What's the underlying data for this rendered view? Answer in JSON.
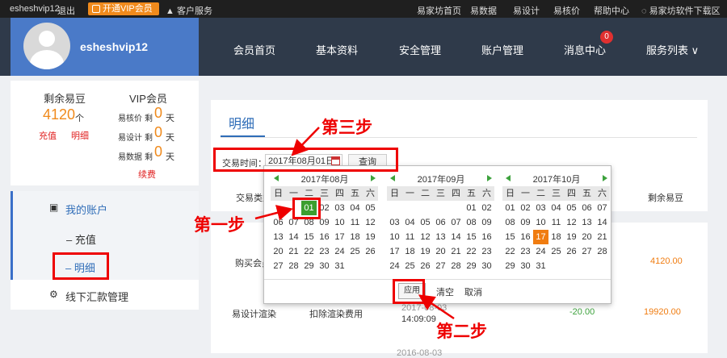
{
  "topbar": {
    "username": "esheshvip12",
    "logout": "退出",
    "vip_button": "开通VIP会员",
    "customer_service": "客户服务",
    "links": [
      "易家坊首页",
      "易数据",
      "易设计",
      "易核价",
      "帮助中心"
    ],
    "download": "易家坊软件下载区"
  },
  "header": {
    "username": "esheshvip12",
    "nav": [
      "会员首页",
      "基本资料",
      "安全管理",
      "账户管理",
      "消息中心",
      "服务列表 ∨"
    ],
    "message_count": "0"
  },
  "balance": {
    "title": "剩余易豆",
    "amount": "4120",
    "unit": "个",
    "recharge": "充值",
    "detail": "明细"
  },
  "vip": {
    "title": "VIP会员",
    "rows": [
      {
        "label": "易核价",
        "mid": "剩",
        "value": "0",
        "unit": "天"
      },
      {
        "label": "易设计",
        "mid": "剩",
        "value": "0",
        "unit": "天"
      },
      {
        "label": "易数据",
        "mid": "剩",
        "value": "0",
        "unit": "天"
      }
    ],
    "renew": "续费"
  },
  "menu": {
    "my_account": "我的账户",
    "recharge": "– 充值",
    "detail": "– 明细",
    "offline": "线下汇款管理"
  },
  "main": {
    "tab": "明细",
    "time_label": "交易时间：",
    "date_value": "2017年08月01日",
    "query_button": "查询",
    "col_type": "交易类型",
    "col_balance": "剩余易豆",
    "row1_type": "购买会员",
    "row1_balance": "4120.00",
    "row2_type": "易设计渲染",
    "row2_desc": "扣除渲染费用",
    "row2_time": "14:09:09",
    "row2_time_top": "2017-08-03",
    "row2_amount": "-20.00",
    "row2_balance": "19920.00",
    "row3_time": "2016-08-03"
  },
  "calendar": {
    "weekdays": [
      "日",
      "一",
      "二",
      "三",
      "四",
      "五",
      "六"
    ],
    "months": [
      {
        "title": "2017年08月",
        "days": [
          "",
          "",
          "01",
          "02",
          "03",
          "04",
          "05",
          "06",
          "07",
          "08",
          "09",
          "10",
          "11",
          "12",
          "13",
          "14",
          "15",
          "16",
          "17",
          "18",
          "19",
          "20",
          "21",
          "22",
          "23",
          "24",
          "25",
          "26",
          "27",
          "28",
          "29",
          "30",
          "31"
        ],
        "selected": "01"
      },
      {
        "title": "2017年09月",
        "days": [
          "",
          "",
          "",
          "",
          "",
          "01",
          "02",
          "03",
          "04",
          "05",
          "06",
          "07",
          "08",
          "09",
          "10",
          "11",
          "12",
          "13",
          "14",
          "15",
          "16",
          "17",
          "18",
          "19",
          "20",
          "21",
          "22",
          "23",
          "24",
          "25",
          "26",
          "27",
          "28",
          "29",
          "30"
        ]
      },
      {
        "title": "2017年10月",
        "days": [
          "01",
          "02",
          "03",
          "04",
          "05",
          "06",
          "07",
          "08",
          "09",
          "10",
          "11",
          "12",
          "13",
          "14",
          "15",
          "16",
          "17",
          "18",
          "19",
          "20",
          "21",
          "22",
          "23",
          "24",
          "25",
          "26",
          "27",
          "28",
          "29",
          "30",
          "31"
        ],
        "today": "17"
      }
    ],
    "apply": "应用",
    "clear": "清空",
    "cancel": "取消"
  },
  "annotations": {
    "step1": "第一步",
    "step2": "第二步",
    "step3": "第三步",
    "color": "#e00000"
  }
}
